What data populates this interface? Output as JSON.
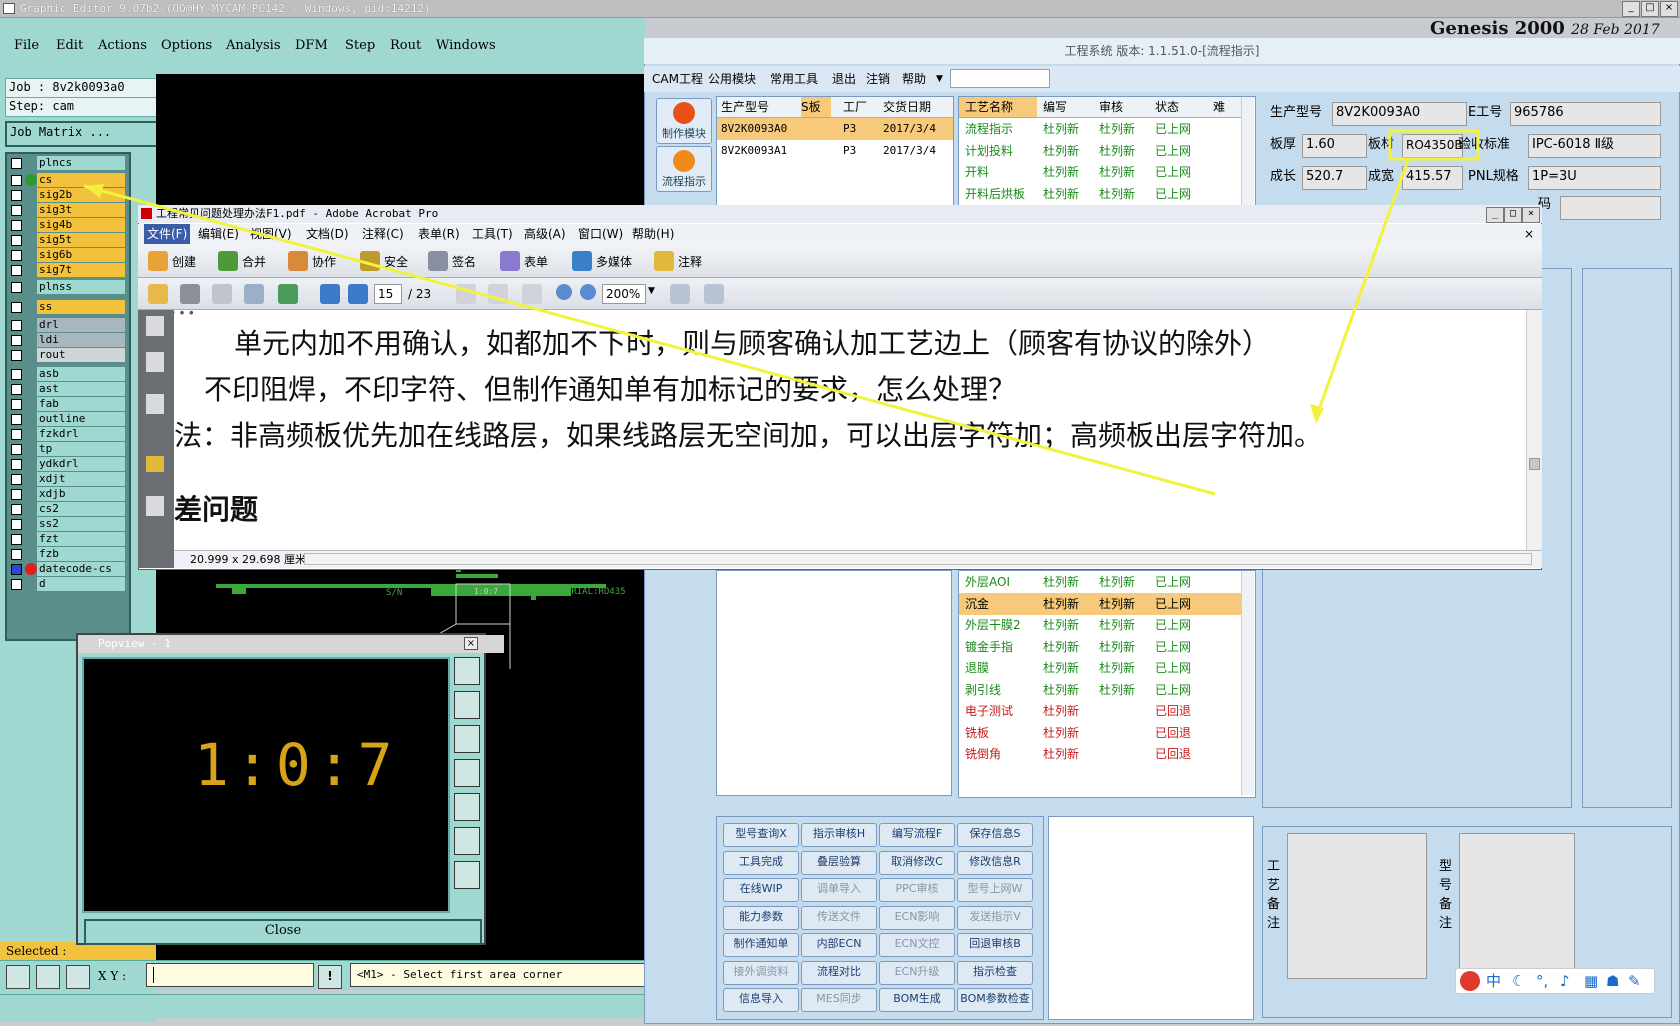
{
  "ge": {
    "title": "Graphic Editor 9.07b2 (OO@HY-MYCAM-PC142 - Windows, pid:14212)",
    "menu": [
      "File",
      "Edit",
      "Actions",
      "Options",
      "Analysis",
      "DFM",
      "Step",
      "Rout",
      "Windows"
    ],
    "job": "Job : 8v2k0093a0",
    "step": "Step: cam",
    "job_matrix": "Job Matrix ...",
    "layers": [
      {
        "name": "plncs",
        "color": "teal"
      },
      {
        "name": "cs",
        "color": "yellow"
      },
      {
        "name": "sig2b",
        "color": "yellow"
      },
      {
        "name": "sig3t",
        "color": "yellow"
      },
      {
        "name": "sig4b",
        "color": "yellow"
      },
      {
        "name": "sig5t",
        "color": "yellow"
      },
      {
        "name": "sig6b",
        "color": "yellow"
      },
      {
        "name": "sig7t",
        "color": "yellow"
      },
      {
        "name": "plnss",
        "color": "teal"
      },
      {
        "name": "ss",
        "color": "yellow"
      },
      {
        "name": "drl",
        "color": "gray"
      },
      {
        "name": "ldi",
        "color": "gray"
      },
      {
        "name": "rout",
        "color": "gray2"
      },
      {
        "name": "asb",
        "color": "teal"
      },
      {
        "name": "ast",
        "color": "teal"
      },
      {
        "name": "fab",
        "color": "teal"
      },
      {
        "name": "outline",
        "color": "teal"
      },
      {
        "name": "fzkdrl",
        "color": "teal"
      },
      {
        "name": "tp",
        "color": "teal"
      },
      {
        "name": "ydkdrl",
        "color": "teal"
      },
      {
        "name": "xdjt",
        "color": "teal"
      },
      {
        "name": "xdjb",
        "color": "teal"
      },
      {
        "name": "cs2",
        "color": "teal"
      },
      {
        "name": "ss2",
        "color": "teal"
      },
      {
        "name": "fzt",
        "color": "teal"
      },
      {
        "name": "fzb",
        "color": "teal"
      },
      {
        "name": "datecode-cs",
        "color": "teal"
      },
      {
        "name": "d",
        "color": "teal"
      }
    ],
    "selected_label": "Selected :",
    "xy_label": "X Y :",
    "prompt": "<M1> - Select first area corner",
    "canvas_text1": "S/N",
    "canvas_text2": "PCB MATERIAL:RO435",
    "canvas_text3": "1:0:7"
  },
  "popview": {
    "title": "Popview - 1",
    "digits": "1:0:7",
    "close_label": "Close"
  },
  "acrobat": {
    "title": "工程常见问题处理办法F1.pdf - Adobe Acrobat Pro",
    "menu": [
      "文件(F)",
      "编辑(E)",
      "视图(V)",
      "文档(D)",
      "注释(C)",
      "表单(R)",
      "工具(T)",
      "高级(A)",
      "窗口(W)",
      "帮助(H)"
    ],
    "toolbar": [
      "创建",
      "合并",
      "协作",
      "安全",
      "签名",
      "表单",
      "多媒体",
      "注释"
    ],
    "page_current": "15",
    "page_total": "/ 23",
    "zoom": "200%",
    "doc_lines": [
      "单元内加不用确认，如都加不下时，则与顾客确认加工艺边上（顾客有协议的除外）",
      "不印阻焊，不印字符、但制作通知单有加标记的要求，怎么处理？",
      "法：非高频板优先加在线路层，如果线路层无空间加，可以出层字符加；高频板出层字符加。",
      "差问题"
    ],
    "page_size": "20.999 x 29.698 厘米"
  },
  "eng": {
    "title": "工程系统 版本: 1.1.51.0-[流程指示]",
    "menu": [
      "CAM工程",
      "公用模块",
      "常用工具",
      "退出",
      "注销",
      "帮助"
    ],
    "side_buttons": [
      "制作模块",
      "流程指示"
    ],
    "genesis_title": "Genesis 2000",
    "genesis_date": "28 Feb 2017",
    "order_headers": [
      "生产型号",
      "S板",
      "工厂",
      "交货日期"
    ],
    "orders": [
      {
        "model": "8V2K0093A0",
        "s": "",
        "factory": "P3",
        "date": "2017/3/4"
      },
      {
        "model": "8V2K0093A1",
        "s": "",
        "factory": "P3",
        "date": "2017/3/4"
      }
    ],
    "process_headers": [
      "工艺名称",
      "编写",
      "审核",
      "状态",
      "难"
    ],
    "process_top": [
      {
        "name": "流程指示",
        "writer": "杜列新",
        "reviewer": "杜列新",
        "status": "已上网",
        "tone": "green"
      },
      {
        "name": "计划投料",
        "writer": "杜列新",
        "reviewer": "杜列新",
        "status": "已上网",
        "tone": "green"
      },
      {
        "name": "开料",
        "writer": "杜列新",
        "reviewer": "杜列新",
        "status": "已上网",
        "tone": "green"
      },
      {
        "name": "开料后烘板",
        "writer": "杜列新",
        "reviewer": "杜列新",
        "status": "已上网",
        "tone": "green"
      }
    ],
    "process_bottom": [
      {
        "name": "外层AOI",
        "writer": "杜列新",
        "reviewer": "杜列新",
        "status": "已上网",
        "tone": "green"
      },
      {
        "name": "沉金",
        "writer": "杜列新",
        "reviewer": "杜列新",
        "status": "已上网",
        "tone": "highlight"
      },
      {
        "name": "外层干膜2",
        "writer": "杜列新",
        "reviewer": "杜列新",
        "status": "已上网",
        "tone": "green"
      },
      {
        "name": "镀金手指",
        "writer": "杜列新",
        "reviewer": "杜列新",
        "status": "已上网",
        "tone": "green"
      },
      {
        "name": "退膜",
        "writer": "杜列新",
        "reviewer": "杜列新",
        "status": "已上网",
        "tone": "green"
      },
      {
        "name": "剥引线",
        "writer": "杜列新",
        "reviewer": "杜列新",
        "status": "已上网",
        "tone": "green"
      },
      {
        "name": "电子测试",
        "writer": "杜列新",
        "reviewer": "",
        "status": "已回退",
        "tone": "red"
      },
      {
        "name": "铣板",
        "writer": "杜列新",
        "reviewer": "",
        "status": "已回退",
        "tone": "red"
      },
      {
        "name": "铣倒角",
        "writer": "杜列新",
        "reviewer": "",
        "status": "已回退",
        "tone": "red"
      }
    ],
    "info": {
      "model_label": "生产型号",
      "model": "8V2K0093A0",
      "e_label": "E工号",
      "e": "965786",
      "thick_label": "板厚",
      "thick": "1.60",
      "mat_label": "板材",
      "mat": "RO4350B",
      "acc_label": "验收标准",
      "acc": "IPC-6018 Ⅱ级",
      "len_label": "成长",
      "len": "520.7",
      "wid_label": "成宽",
      "wid": "415.57",
      "pnl_label": "PNL规格",
      "pnl": "1P=3U",
      "code_label": "码"
    },
    "note_labels": [
      "工艺备注",
      "型号备注"
    ],
    "actions": [
      [
        {
          "t": "型号查询X",
          "d": false
        },
        {
          "t": "指示审核H",
          "d": false
        },
        {
          "t": "编写流程F",
          "d": false
        },
        {
          "t": "保存信息S",
          "d": false
        }
      ],
      [
        {
          "t": "工具完成",
          "d": false
        },
        {
          "t": "叠层验算",
          "d": false
        },
        {
          "t": "取消修改C",
          "d": false
        },
        {
          "t": "修改信息R",
          "d": false
        }
      ],
      [
        {
          "t": "在线WIP",
          "d": false
        },
        {
          "t": "调单导入",
          "d": true
        },
        {
          "t": "PPC审核",
          "d": true
        },
        {
          "t": "型号上网W",
          "d": true
        }
      ],
      [
        {
          "t": "能力参数",
          "d": false
        },
        {
          "t": "传送文件",
          "d": true
        },
        {
          "t": "ECN影响",
          "d": true
        },
        {
          "t": "发送指示V",
          "d": true
        }
      ],
      [
        {
          "t": "制作通知单",
          "d": false
        },
        {
          "t": "内部ECN",
          "d": false
        },
        {
          "t": "ECN文控",
          "d": true
        },
        {
          "t": "回退审核B",
          "d": false
        }
      ],
      [
        {
          "t": "接外调资料",
          "d": true
        },
        {
          "t": "流程对比",
          "d": false
        },
        {
          "t": "ECN升级",
          "d": true
        },
        {
          "t": "指示检查",
          "d": false
        }
      ],
      [
        {
          "t": "信息导入",
          "d": false
        },
        {
          "t": "MES同步",
          "d": true
        },
        {
          "t": "BOM生成",
          "d": false
        },
        {
          "t": "BOM参数检查",
          "d": false
        }
      ]
    ]
  },
  "ime": {
    "label": "中"
  },
  "colors": {
    "annotation": "#f2f23c",
    "highlight": "#f7c97a",
    "teal": "#9fd8d0"
  }
}
